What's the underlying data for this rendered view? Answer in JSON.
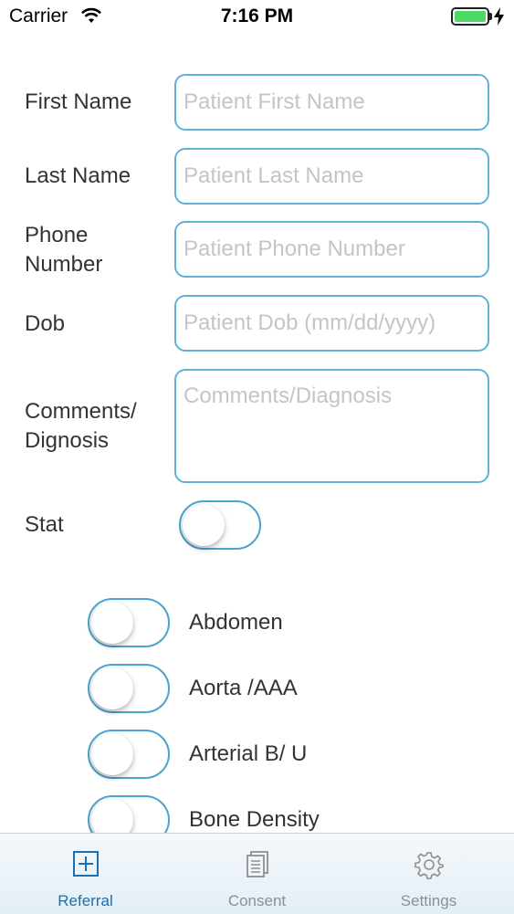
{
  "status_bar": {
    "carrier": "Carrier",
    "time": "7:16 PM",
    "battery_color": "#4cd964"
  },
  "form": {
    "first_name": {
      "label": "First Name",
      "placeholder": "Patient First Name",
      "value": ""
    },
    "last_name": {
      "label": "Last Name",
      "placeholder": "Patient Last Name",
      "value": ""
    },
    "phone": {
      "label_line1": "Phone",
      "label_line2": "Number",
      "placeholder": "Patient Phone Number",
      "value": ""
    },
    "dob": {
      "label": "Dob",
      "placeholder": "Patient Dob (mm/dd/yyyy)",
      "value": ""
    },
    "comments": {
      "label_line1": "Comments/",
      "label_line2": "Dignosis",
      "placeholder": "Comments/Diagnosis",
      "value": ""
    },
    "stat": {
      "label": "Stat",
      "on": false
    }
  },
  "exam_options": [
    {
      "label": "Abdomen",
      "on": false
    },
    {
      "label": "Aorta /AAA",
      "on": false
    },
    {
      "label": "Arterial B/ U",
      "on": false
    },
    {
      "label": "Bone Density",
      "on": false
    }
  ],
  "tab_bar": {
    "tabs": [
      {
        "label": "Referral",
        "icon": "plus-square-icon",
        "active": true
      },
      {
        "label": "Consent",
        "icon": "document-stack-icon",
        "active": false
      },
      {
        "label": "Settings",
        "icon": "gear-icon",
        "active": false
      }
    ],
    "active_color": "#1a6fb5",
    "inactive_color": "#8e8e93"
  },
  "colors": {
    "field_border": "#5fb2d6",
    "toggle_border": "#4aa3cf"
  }
}
